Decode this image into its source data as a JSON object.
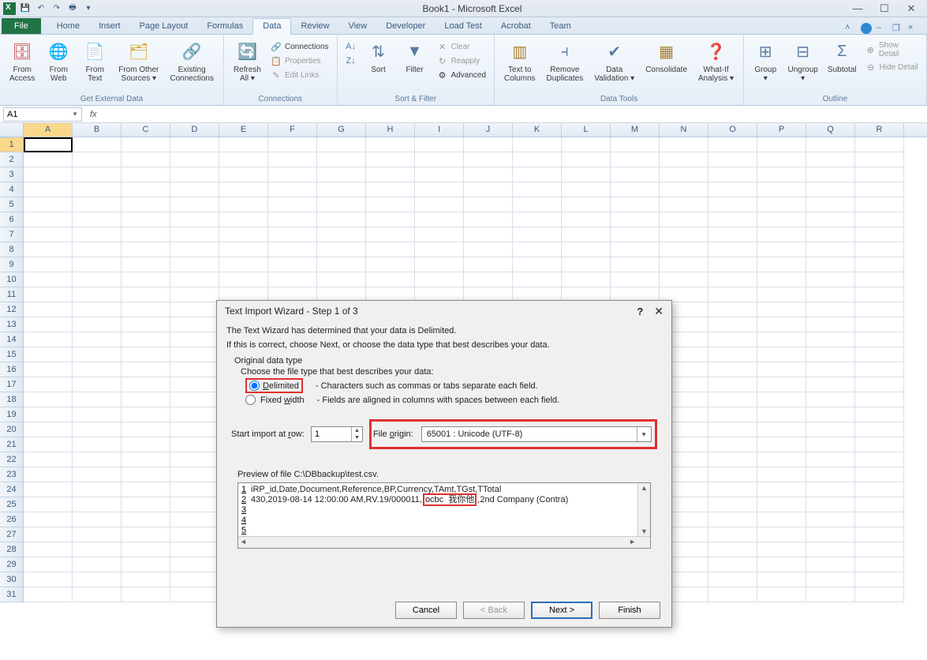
{
  "titlebar": {
    "title": "Book1 - Microsoft Excel"
  },
  "tabs": {
    "file": "File",
    "items": [
      "Home",
      "Insert",
      "Page Layout",
      "Formulas",
      "Data",
      "Review",
      "View",
      "Developer",
      "Load Test",
      "Acrobat",
      "Team"
    ],
    "active": "Data"
  },
  "ribbon": {
    "get_external": {
      "label": "Get External Data",
      "from_access": "From\nAccess",
      "from_web": "From\nWeb",
      "from_text": "From\nText",
      "from_other": "From Other\nSources ▾",
      "existing": "Existing\nConnections"
    },
    "connections": {
      "label": "Connections",
      "refresh": "Refresh\nAll ▾",
      "connections": "Connections",
      "properties": "Properties",
      "edit_links": "Edit Links"
    },
    "sortfilter": {
      "label": "Sort & Filter",
      "sort_az": "A→Z",
      "sort_za": "Z→A",
      "sort": "Sort",
      "filter": "Filter",
      "clear": "Clear",
      "reapply": "Reapply",
      "advanced": "Advanced"
    },
    "datatools": {
      "label": "Data Tools",
      "text_to_cols": "Text to\nColumns",
      "remove_dup": "Remove\nDuplicates",
      "validation": "Data\nValidation ▾",
      "consolidate": "Consolidate",
      "whatif": "What-If\nAnalysis ▾"
    },
    "outline": {
      "label": "Outline",
      "group": "Group\n▾",
      "ungroup": "Ungroup\n▾",
      "subtotal": "Subtotal",
      "show_detail": "Show Detail",
      "hide_detail": "Hide Detail"
    }
  },
  "namebox": "A1",
  "columns": [
    "A",
    "B",
    "C",
    "D",
    "E",
    "F",
    "G",
    "H",
    "I",
    "J",
    "K",
    "L",
    "M",
    "N",
    "O",
    "P",
    "Q",
    "R"
  ],
  "rows": 31,
  "dialog": {
    "title": "Text Import Wizard - Step 1 of 3",
    "line1": "The Text Wizard has determined that your data is Delimited.",
    "line2": "If this is correct, choose Next, or choose the data type that best describes your data.",
    "orig_label": "Original data type",
    "choose_label": "Choose the file type that best describes your data:",
    "delimited": "Delimited",
    "delimited_desc": "- Characters such as commas or tabs separate each field.",
    "fixed": "Fixed width",
    "fixed_desc": "- Fields are aligned in columns with spaces between each field.",
    "start_row_label": "Start import at row:",
    "start_row": "1",
    "file_origin_label": "File origin:",
    "file_origin": "65001 : Unicode (UTF-8)",
    "preview_label": "Preview of file C:\\DBbackup\\test.csv.",
    "preview_lines": [
      "iRP_id,Date,Document,Reference,BP,Currency,TAmt,TGst,TTotal",
      "430,2019-08-14 12:00:00 AM,RV.19/000011,|ocbc  我你他|,2nd Company (Contra)"
    ],
    "cancel": "Cancel",
    "back": "< Back",
    "next": "Next >",
    "finish": "Finish"
  }
}
